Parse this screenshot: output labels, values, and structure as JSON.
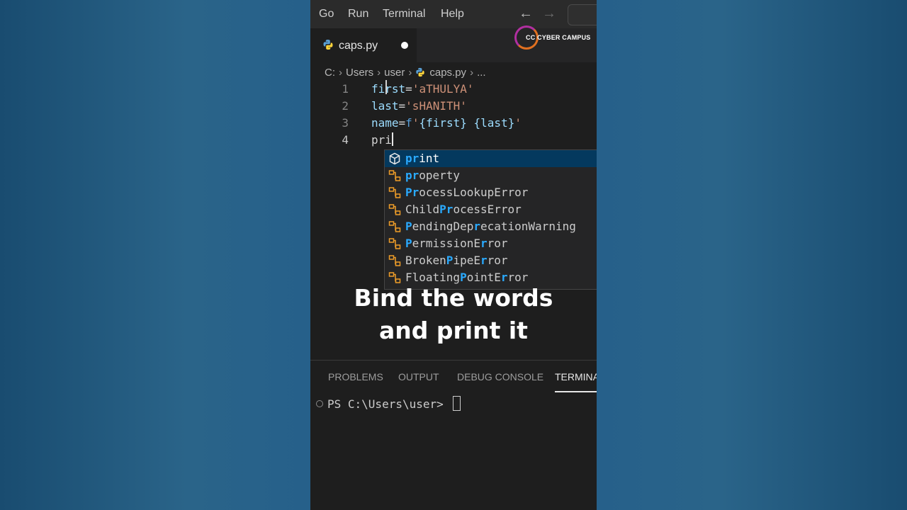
{
  "menubar": {
    "items": [
      "Go",
      "Run",
      "Terminal",
      "Help"
    ]
  },
  "tab": {
    "filename": "caps.py"
  },
  "logo": {
    "text": "CC CYBER CAMPUS"
  },
  "breadcrumb": {
    "parts": [
      "C:",
      "Users",
      "user",
      "caps.py",
      "..."
    ]
  },
  "editor": {
    "line_numbers": [
      "1",
      "2",
      "3",
      "4"
    ],
    "lines": [
      {
        "var": "first",
        "op": "=",
        "str": "'aTHULYA'"
      },
      {
        "var": "last",
        "op": "=",
        "str": "'sHANITH'"
      },
      {
        "var": "name",
        "op": "=",
        "prefix": "f",
        "q1": "'",
        "e1": "{first}",
        "sp": " ",
        "e2": "{last}",
        "q2": "'"
      },
      {
        "typed": "pri"
      }
    ]
  },
  "suggestions": [
    {
      "icon": "cube-icon",
      "label": "print",
      "selected": true
    },
    {
      "icon": "class-icon",
      "label": "property"
    },
    {
      "icon": "class-icon",
      "label": "ProcessLookupError"
    },
    {
      "icon": "class-icon",
      "label": "ChildProcessError"
    },
    {
      "icon": "class-icon",
      "label": "PendingDeprecationWarning"
    },
    {
      "icon": "class-icon",
      "label": "PermissionError"
    },
    {
      "icon": "class-icon",
      "label": "BrokenPipeError"
    },
    {
      "icon": "class-icon",
      "label": "FloatingPointError"
    }
  ],
  "caption": {
    "line1": "Bind the words",
    "line2": "and print it"
  },
  "panel": {
    "tabs": [
      "PROBLEMS",
      "OUTPUT",
      "DEBUG CONSOLE",
      "TERMINA"
    ],
    "active_tab": "TERMINA",
    "prompt": "PS C:\\Users\\user> "
  },
  "colors": {
    "accent": "#04395e",
    "match_highlight": "#2aaaff",
    "string": "#ce9178",
    "variable": "#9cdcfe"
  }
}
